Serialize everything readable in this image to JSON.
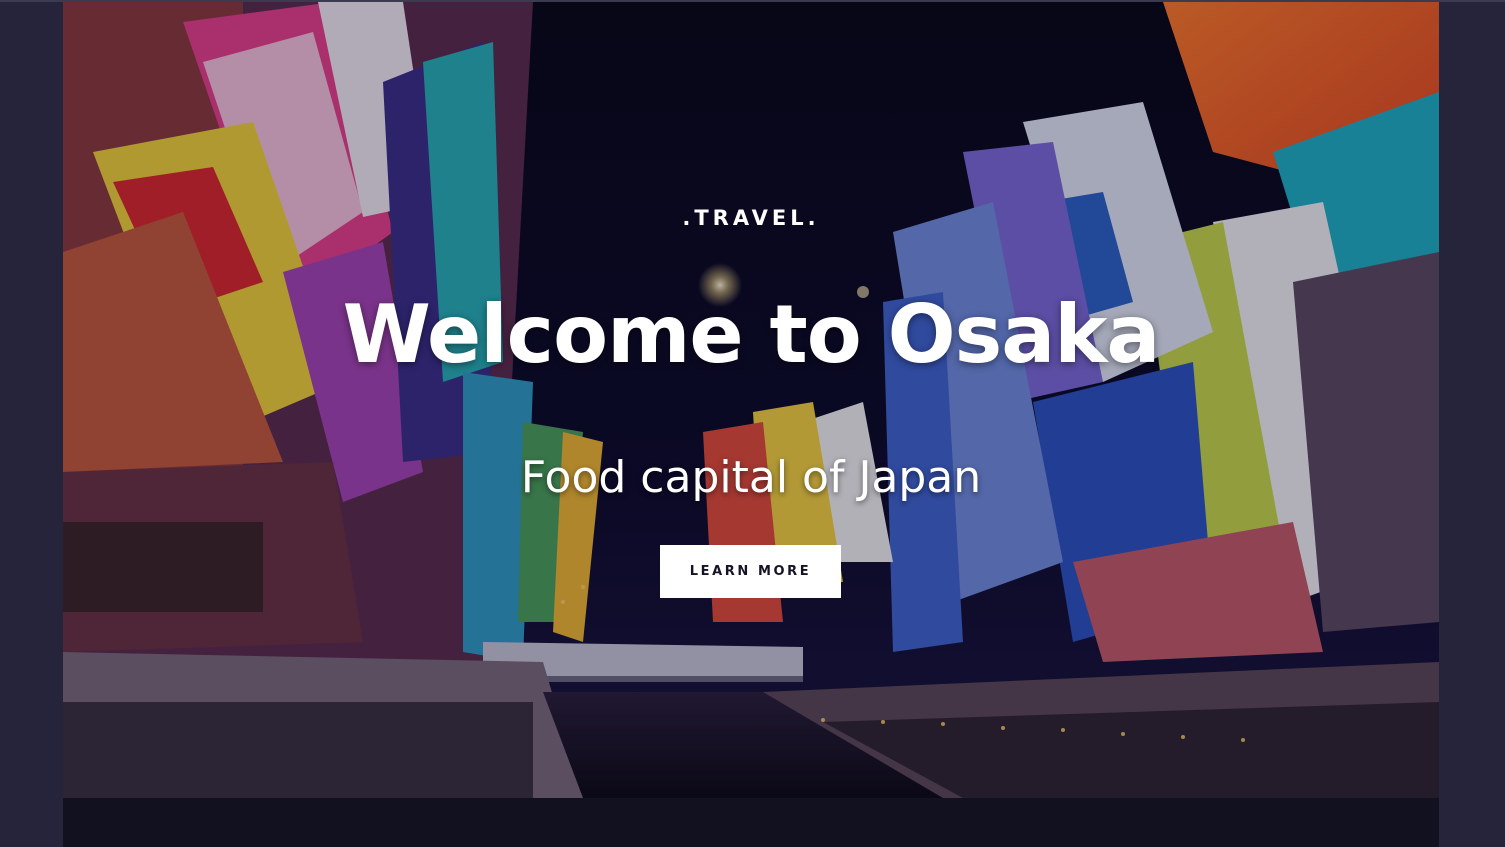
{
  "hero": {
    "eyebrow": ".TRAVEL.",
    "title": "Welcome to Osaka",
    "subtitle": "Food capital of Japan",
    "cta_label": "LEARN MORE",
    "background_image": "osaka-dotonbori-night-scene"
  },
  "colors": {
    "page_background": "#26243a",
    "section_background": "#12111f",
    "button_background": "#ffffff",
    "button_text": "#151426",
    "text": "#ffffff"
  }
}
